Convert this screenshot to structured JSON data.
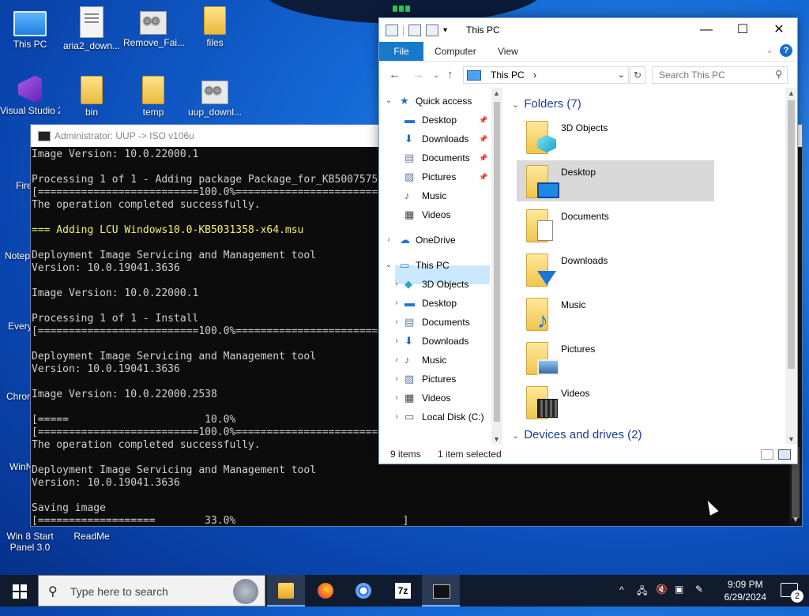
{
  "desktop": {
    "icons": [
      {
        "label": "This PC"
      },
      {
        "label": "aria2_down..."
      },
      {
        "label": "Remove_Fai..."
      },
      {
        "label": "files"
      },
      {
        "label": "Visual Studio 20..."
      },
      {
        "label": "bin"
      },
      {
        "label": "temp"
      },
      {
        "label": "uup_downl..."
      },
      {
        "label": "Win 8 Start Panel 3.0"
      },
      {
        "label": "ReadMe"
      }
    ],
    "partial_labels": [
      "Fire",
      "Notep",
      "Every",
      "Chron",
      "WinN"
    ]
  },
  "console": {
    "title": "Administrator:  UUP -> ISO v106u",
    "lines": [
      {
        "text": "Image Version: 10.0.22000.1",
        "highlight": false
      },
      {
        "text": "",
        "highlight": false
      },
      {
        "text": "Processing 1 of 1 - Adding package Package_for_KB5007575",
        "highlight": false
      },
      {
        "text": "[==========================100.0%==========================]",
        "highlight": false
      },
      {
        "text": "The operation completed successfully.",
        "highlight": false
      },
      {
        "text": "",
        "highlight": false
      },
      {
        "text": "=== Adding LCU Windows10.0-KB5031358-x64.msu",
        "highlight": true
      },
      {
        "text": "",
        "highlight": false
      },
      {
        "text": "Deployment Image Servicing and Management tool",
        "highlight": false
      },
      {
        "text": "Version: 10.0.19041.3636",
        "highlight": false
      },
      {
        "text": "",
        "highlight": false
      },
      {
        "text": "Image Version: 10.0.22000.1",
        "highlight": false
      },
      {
        "text": "",
        "highlight": false
      },
      {
        "text": "Processing 1 of 1 - Install",
        "highlight": false
      },
      {
        "text": "[==========================100.0%==========================]",
        "highlight": false
      },
      {
        "text": "",
        "highlight": false
      },
      {
        "text": "Deployment Image Servicing and Management tool",
        "highlight": false
      },
      {
        "text": "Version: 10.0.19041.3636",
        "highlight": false
      },
      {
        "text": "",
        "highlight": false
      },
      {
        "text": "Image Version: 10.0.22000.2538",
        "highlight": false
      },
      {
        "text": "",
        "highlight": false
      },
      {
        "text": "[=====                      10.0%                           ]",
        "highlight": false
      },
      {
        "text": "[==========================100.0%==========================]",
        "highlight": false
      },
      {
        "text": "The operation completed successfully.",
        "highlight": false
      },
      {
        "text": "",
        "highlight": false
      },
      {
        "text": "Deployment Image Servicing and Management tool",
        "highlight": false
      },
      {
        "text": "Version: 10.0.19041.3636",
        "highlight": false
      },
      {
        "text": "",
        "highlight": false
      },
      {
        "text": "Saving image",
        "highlight": false
      },
      {
        "text": "[===================        33.0%                           ]",
        "highlight": false
      }
    ]
  },
  "explorer": {
    "title": "This PC",
    "ribbon_tabs": [
      "File",
      "Computer",
      "View"
    ],
    "address": "This PC",
    "search_placeholder": "Search This PC",
    "nav": [
      {
        "label": "Quick access",
        "level": 0,
        "expanded": true,
        "icon": "star-icon",
        "pinned": false
      },
      {
        "label": "Desktop",
        "level": 1,
        "icon": "desktop-icon",
        "pinned": true
      },
      {
        "label": "Downloads",
        "level": 1,
        "icon": "download-icon",
        "pinned": true
      },
      {
        "label": "Documents",
        "level": 1,
        "icon": "document-icon",
        "pinned": true
      },
      {
        "label": "Pictures",
        "level": 1,
        "icon": "picture-icon",
        "pinned": true
      },
      {
        "label": "Music",
        "level": 1,
        "icon": "music-icon",
        "pinned": false
      },
      {
        "label": "Videos",
        "level": 1,
        "icon": "video-icon",
        "pinned": false
      },
      {
        "label": "OneDrive",
        "level": 0,
        "expanded": false,
        "icon": "cloud-icon",
        "pinned": false
      },
      {
        "label": "This PC",
        "level": 0,
        "expanded": true,
        "icon": "pc-icon",
        "pinned": false,
        "selected": true
      },
      {
        "label": "3D Objects",
        "level": 1,
        "icon": "cube-icon",
        "pinned": false,
        "expandable": true
      },
      {
        "label": "Desktop",
        "level": 1,
        "icon": "desktop-icon",
        "pinned": false,
        "expandable": true
      },
      {
        "label": "Documents",
        "level": 1,
        "icon": "document-icon",
        "pinned": false,
        "expandable": true
      },
      {
        "label": "Downloads",
        "level": 1,
        "icon": "download-icon",
        "pinned": false,
        "expandable": true
      },
      {
        "label": "Music",
        "level": 1,
        "icon": "music-icon",
        "pinned": false,
        "expandable": true
      },
      {
        "label": "Pictures",
        "level": 1,
        "icon": "picture-icon",
        "pinned": false,
        "expandable": true
      },
      {
        "label": "Videos",
        "level": 1,
        "icon": "video-icon",
        "pinned": false,
        "expandable": true
      },
      {
        "label": "Local Disk (C:)",
        "level": 1,
        "icon": "drive-icon",
        "pinned": false,
        "expandable": true
      }
    ],
    "folders_header": "Folders (7)",
    "folders": [
      {
        "label": "3D Objects",
        "overlay": "cube-icon",
        "selected": false
      },
      {
        "label": "Desktop",
        "overlay": "desktop-icon",
        "selected": true
      },
      {
        "label": "Documents",
        "overlay": "document-icon",
        "selected": false
      },
      {
        "label": "Downloads",
        "overlay": "download-icon",
        "selected": false
      },
      {
        "label": "Music",
        "overlay": "music-icon",
        "selected": false
      },
      {
        "label": "Pictures",
        "overlay": "picture-icon",
        "selected": false
      },
      {
        "label": "Videos",
        "overlay": "video-icon",
        "selected": false
      }
    ],
    "drives_header": "Devices and drives (2)",
    "status_items": "9 items",
    "status_selected": "1 item selected"
  },
  "taskbar": {
    "search_placeholder": "Type here to search",
    "time": "9:09 PM",
    "date": "6/29/2024",
    "notification_count": "2",
    "apps": [
      {
        "name": "file-explorer",
        "active": true
      },
      {
        "name": "firefox",
        "active": false
      },
      {
        "name": "chromium",
        "active": false
      },
      {
        "name": "7-zip",
        "active": false
      },
      {
        "name": "command-prompt",
        "active": true
      }
    ],
    "seven_zip_label": "7z"
  },
  "colors": {
    "accent": "#1979ca",
    "console_bg": "#0c0c0c",
    "console_highlight": "#f3f06b",
    "taskbar": "#101b2e",
    "selection": "#cce8ff"
  }
}
